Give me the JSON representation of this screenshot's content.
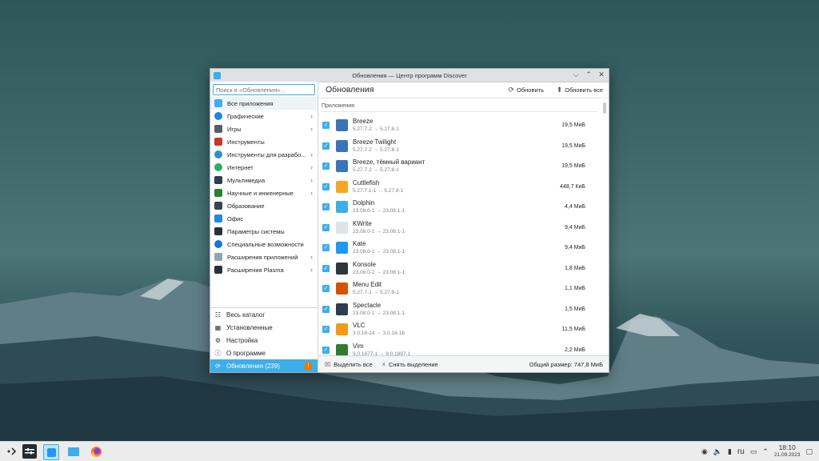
{
  "window": {
    "title": "Обновления — Центр программ Discover",
    "controls": [
      "⌵",
      "⌃",
      "✕"
    ]
  },
  "sidebar": {
    "search_placeholder": "Поиск в «Обновления»...",
    "categories": [
      {
        "label": "Все приложения",
        "icon": "grid-icon",
        "color": "#3daee9",
        "chevron": false
      },
      {
        "label": "Графические",
        "icon": "graphics-icon",
        "color": "#1e88e5",
        "chevron": true
      },
      {
        "label": "Игры",
        "icon": "gamepad-icon",
        "color": "#555e66",
        "chevron": true
      },
      {
        "label": "Инструменты",
        "icon": "toolbox-icon",
        "color": "#c0392b",
        "chevron": false
      },
      {
        "label": "Инструменты для разрабо...",
        "icon": "globe-dev-icon",
        "color": "#2d8fd5",
        "chevron": true
      },
      {
        "label": "Интернет",
        "icon": "internet-icon",
        "color": "#27ae60",
        "chevron": true
      },
      {
        "label": "Мультимедиа",
        "icon": "multimedia-icon",
        "color": "#2c3e50",
        "chevron": true
      },
      {
        "label": "Научные и инженерные",
        "icon": "science-icon",
        "color": "#2e7d32",
        "chevron": true
      },
      {
        "label": "Образование",
        "icon": "education-icon",
        "color": "#37474f",
        "chevron": false
      },
      {
        "label": "Офис",
        "icon": "office-icon",
        "color": "#1e88e5",
        "chevron": false
      },
      {
        "label": "Параметры системы",
        "icon": "settings-icon",
        "color": "#263238",
        "chevron": false
      },
      {
        "label": "Специальные возможности",
        "icon": "accessibility-icon",
        "color": "#1976d2",
        "chevron": false
      },
      {
        "label": "Расширения приложений",
        "icon": "plugins-icon",
        "color": "#90a4ae",
        "chevron": true
      },
      {
        "label": "Расширения Plasma",
        "icon": "plasma-icon",
        "color": "#263238",
        "chevron": true
      }
    ],
    "bottom": [
      {
        "label": "Весь каталог",
        "icon": "catalog-icon",
        "glyph": "☷"
      },
      {
        "label": "Установленные",
        "icon": "installed-icon",
        "glyph": "▦"
      },
      {
        "label": "Настройка",
        "icon": "configure-icon",
        "glyph": "⚙"
      },
      {
        "label": "О программе",
        "icon": "info-icon",
        "glyph": "ⓘ"
      },
      {
        "label": "Обновления (239)",
        "icon": "updates-icon",
        "glyph": "⟳",
        "active": true,
        "badge": "!"
      }
    ]
  },
  "main": {
    "title": "Обновления",
    "refresh_label": "Обновить",
    "update_all_label": "Обновить все",
    "section_label": "Приложения",
    "packages": [
      {
        "name": "Breeze",
        "version": "5.27.7-2 → 5.27.8-1",
        "size": "19,5 МиБ",
        "icon": "breeze-icon",
        "color": "#3b73b9"
      },
      {
        "name": "Breeze Twilight",
        "version": "5.27.7-2 → 5.27.8-1",
        "size": "19,5 МиБ",
        "icon": "breeze-twilight-icon",
        "color": "#3b73b9"
      },
      {
        "name": "Breeze, тёмный вариант",
        "version": "5.27.7-2 → 5.27.8-1",
        "size": "19,5 МиБ",
        "icon": "breeze-dark-icon",
        "color": "#3b73b9"
      },
      {
        "name": "Cuttlefish",
        "version": "5.27.7.1-1 → 5.27.8-1",
        "size": "448,7 КиБ",
        "icon": "cuttlefish-icon",
        "color": "#f5a623"
      },
      {
        "name": "Dolphin",
        "version": "23.08.0-1 → 23.08.1-1",
        "size": "4,4 МиБ",
        "icon": "dolphin-icon",
        "color": "#3daee9"
      },
      {
        "name": "KWrite",
        "version": "23.08.0-1 → 23.08.1-1",
        "size": "9,4 МиБ",
        "icon": "kwrite-icon",
        "color": "#dfe3e6"
      },
      {
        "name": "Kate",
        "version": "23.08.0-1 → 23.08.1-1",
        "size": "9,4 МиБ",
        "icon": "kate-icon",
        "color": "#1d99f3"
      },
      {
        "name": "Konsole",
        "version": "23.08.0-2 → 23.08.1-1",
        "size": "1,8 МиБ",
        "icon": "konsole-icon",
        "color": "#31363b"
      },
      {
        "name": "Menu Edit",
        "version": "5.27.7-1 → 5.27.8-1",
        "size": "1,1 МиБ",
        "icon": "menu-edit-icon",
        "color": "#d35400"
      },
      {
        "name": "Spectacle",
        "version": "23.08.0-1 → 23.08.1-1",
        "size": "1,5 МиБ",
        "icon": "spectacle-icon",
        "color": "#2c3e50"
      },
      {
        "name": "VLC",
        "version": "3.0.18-14 → 3.0.18-16",
        "size": "11,5 МиБ",
        "icon": "vlc-icon",
        "color": "#f39c12"
      },
      {
        "name": "Vim",
        "version": "9.0.1677-1 → 9.0.1897-1",
        "size": "2,2 МиБ",
        "icon": "vim-icon",
        "color": "#2e7d32"
      }
    ],
    "select_all_label": "Выделить все",
    "deselect_label": "Снять выделение",
    "total_label": "Общий размер: 747,8 МиБ"
  },
  "taskbar": {
    "language": "ru",
    "time": "18:10",
    "date": "21.09.2023"
  }
}
